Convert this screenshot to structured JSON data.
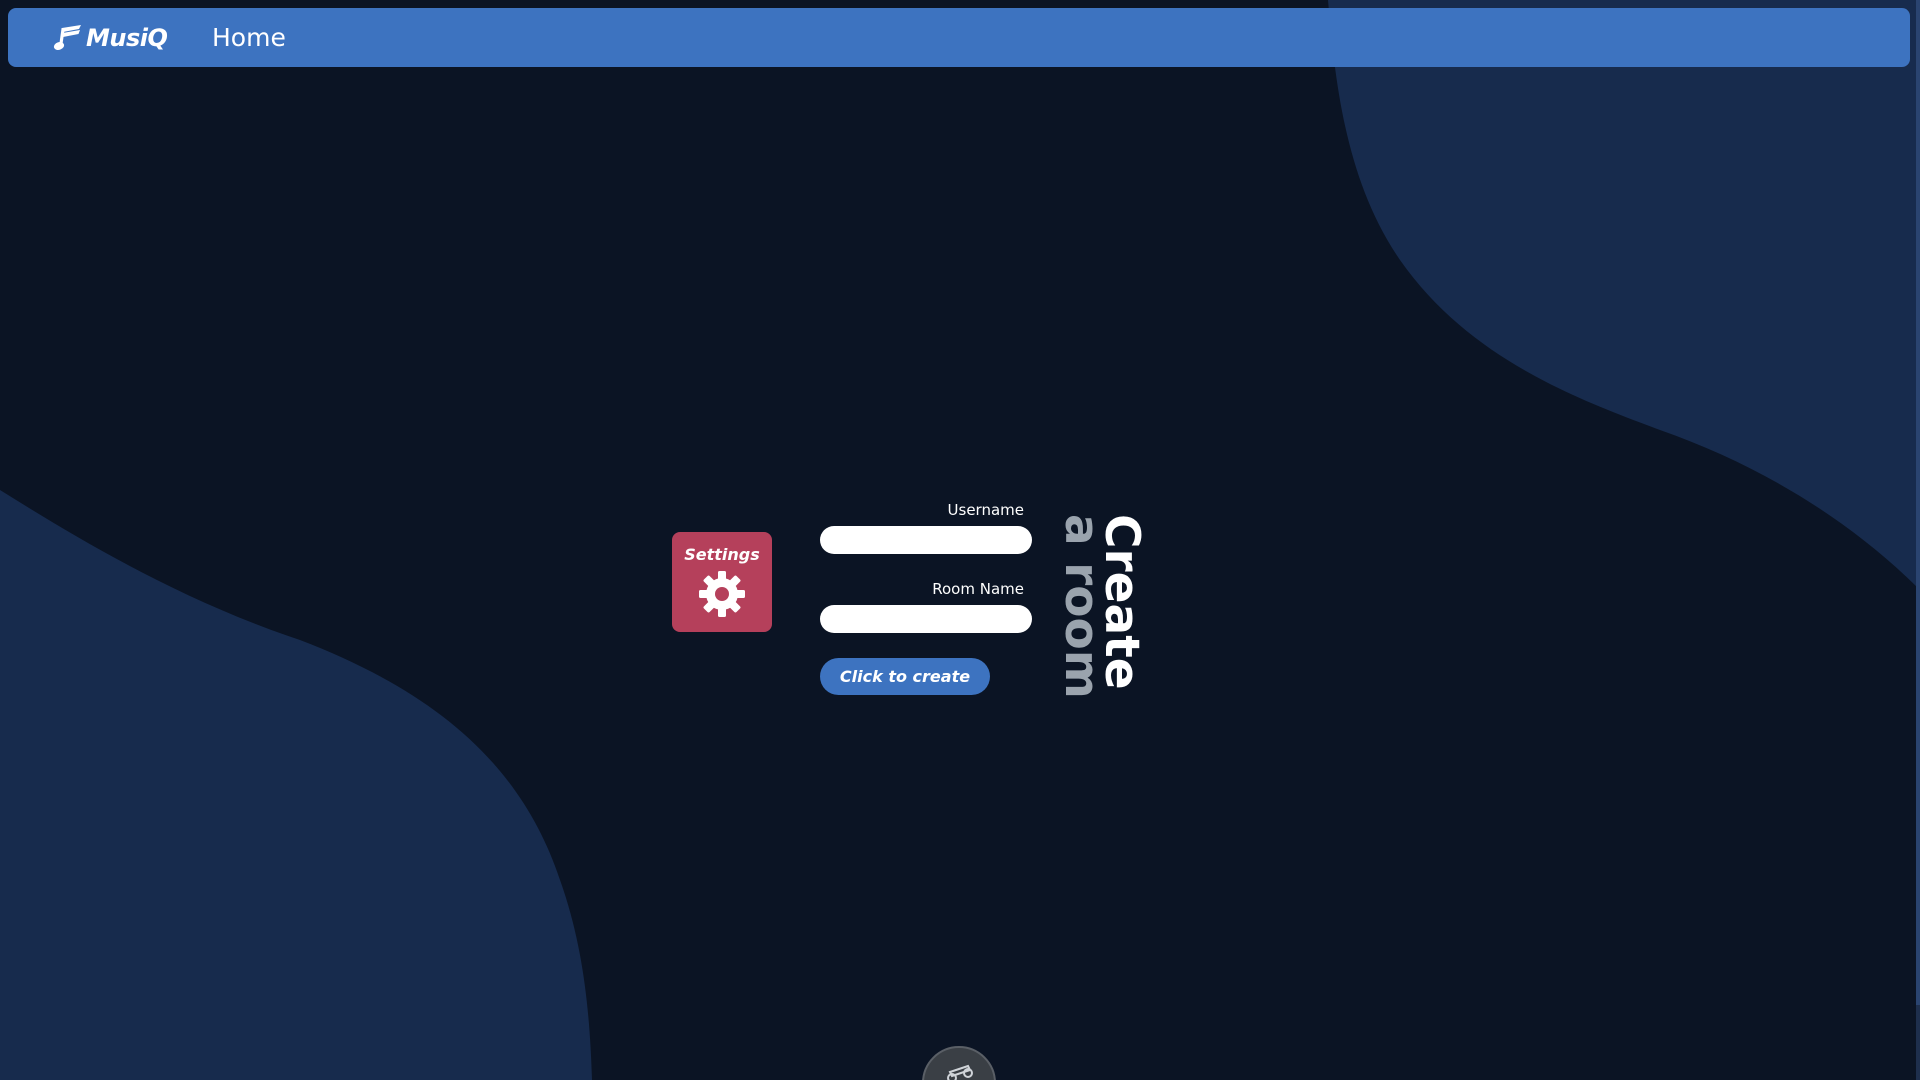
{
  "colors": {
    "background": "#0b1424",
    "blob": "#172b4d",
    "navbar": "#3d73c0",
    "settings_tile": "#b5405b",
    "button": "#3d73c0",
    "title_primary": "#ffffff",
    "title_secondary": "#9aa3ad"
  },
  "navbar": {
    "brand_icon": "music-note-icon",
    "brand": "MusiQ",
    "home": "Home"
  },
  "settings": {
    "label": "Settings",
    "icon": "gear-icon"
  },
  "form": {
    "username_label": "Username",
    "username_value": "",
    "room_name_label": "Room Name",
    "room_name_value": "",
    "submit_label": "Click to create"
  },
  "title": {
    "line1": "Create",
    "line2": "a room"
  },
  "fab": {
    "icon": "music-note-icon"
  }
}
